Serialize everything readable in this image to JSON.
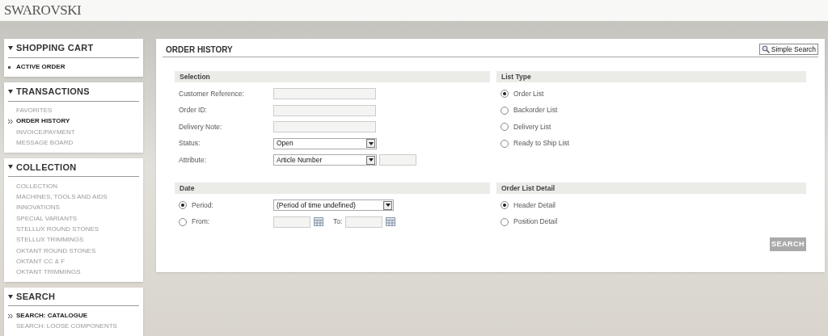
{
  "header": {
    "logo": "SWAROVSKI"
  },
  "sidebar": [
    {
      "title": "SHOPPING CART",
      "kind": "cart",
      "items": [
        {
          "label": "ACTIVE ORDER",
          "selected": true
        }
      ]
    },
    {
      "title": "TRANSACTIONS",
      "kind": "menu",
      "items": [
        {
          "label": "FAVORITES",
          "selected": false
        },
        {
          "label": "ORDER HISTORY",
          "selected": true
        },
        {
          "label": "INVOICE/PAYMENT",
          "selected": false
        },
        {
          "label": "MESSAGE BOARD",
          "selected": false
        }
      ]
    },
    {
      "title": "COLLECTION",
      "items": [
        {
          "label": "COLLECTION",
          "selected": false
        },
        {
          "label": "MACHINES, TOOLS AND AIDS",
          "selected": false
        },
        {
          "label": "INNOVATIONS",
          "selected": false
        },
        {
          "label": "SPECIAL VARIANTS",
          "selected": false
        },
        {
          "label": "STELLUX ROUND STONES",
          "selected": false
        },
        {
          "label": "STELLUX TRIMMINGS",
          "selected": false
        },
        {
          "label": "OKTANT ROUND STONES",
          "selected": false
        },
        {
          "label": "OKTANT CC & F",
          "selected": false
        },
        {
          "label": "OKTANT TRIMMINGS",
          "selected": false
        }
      ]
    },
    {
      "title": "SEARCH",
      "kind": "menu",
      "items": [
        {
          "label": "SEARCH: CATALOGUE",
          "selected": true
        },
        {
          "label": "SEARCH: LOOSE COMPONENTS",
          "selected": false
        }
      ]
    }
  ],
  "main": {
    "title": "ORDER HISTORY",
    "simple_search": "Simple Search",
    "selection": {
      "heading": "Selection",
      "fields": [
        {
          "label": "Customer Reference:",
          "kind": "text"
        },
        {
          "label": "Order ID:",
          "kind": "text"
        },
        {
          "label": "Delivery Note:",
          "kind": "text"
        },
        {
          "label": "Status:",
          "kind": "select",
          "value": "Open"
        },
        {
          "label": "Attribute:",
          "kind": "select_text",
          "value": "Article Number"
        }
      ]
    },
    "list_type": {
      "heading": "List Type",
      "options": [
        {
          "label": "Order List",
          "selected": true
        },
        {
          "label": "Backorder List",
          "selected": false
        },
        {
          "label": "Delivery List",
          "selected": false
        },
        {
          "label": "Ready to Ship List",
          "selected": false
        }
      ]
    },
    "date": {
      "heading": "Date",
      "options": [
        {
          "label": "Period:",
          "kind": "select",
          "selected": true,
          "value": "(Period of time undefined)"
        },
        {
          "label": "From:",
          "kind": "range",
          "selected": false,
          "to_label": "To:"
        }
      ]
    },
    "order_list_detail": {
      "heading": "Order List Detail",
      "options": [
        {
          "label": "Header Detail",
          "selected": true
        },
        {
          "label": "Position Detail",
          "selected": false
        }
      ]
    },
    "search_button": "SEARCH"
  }
}
